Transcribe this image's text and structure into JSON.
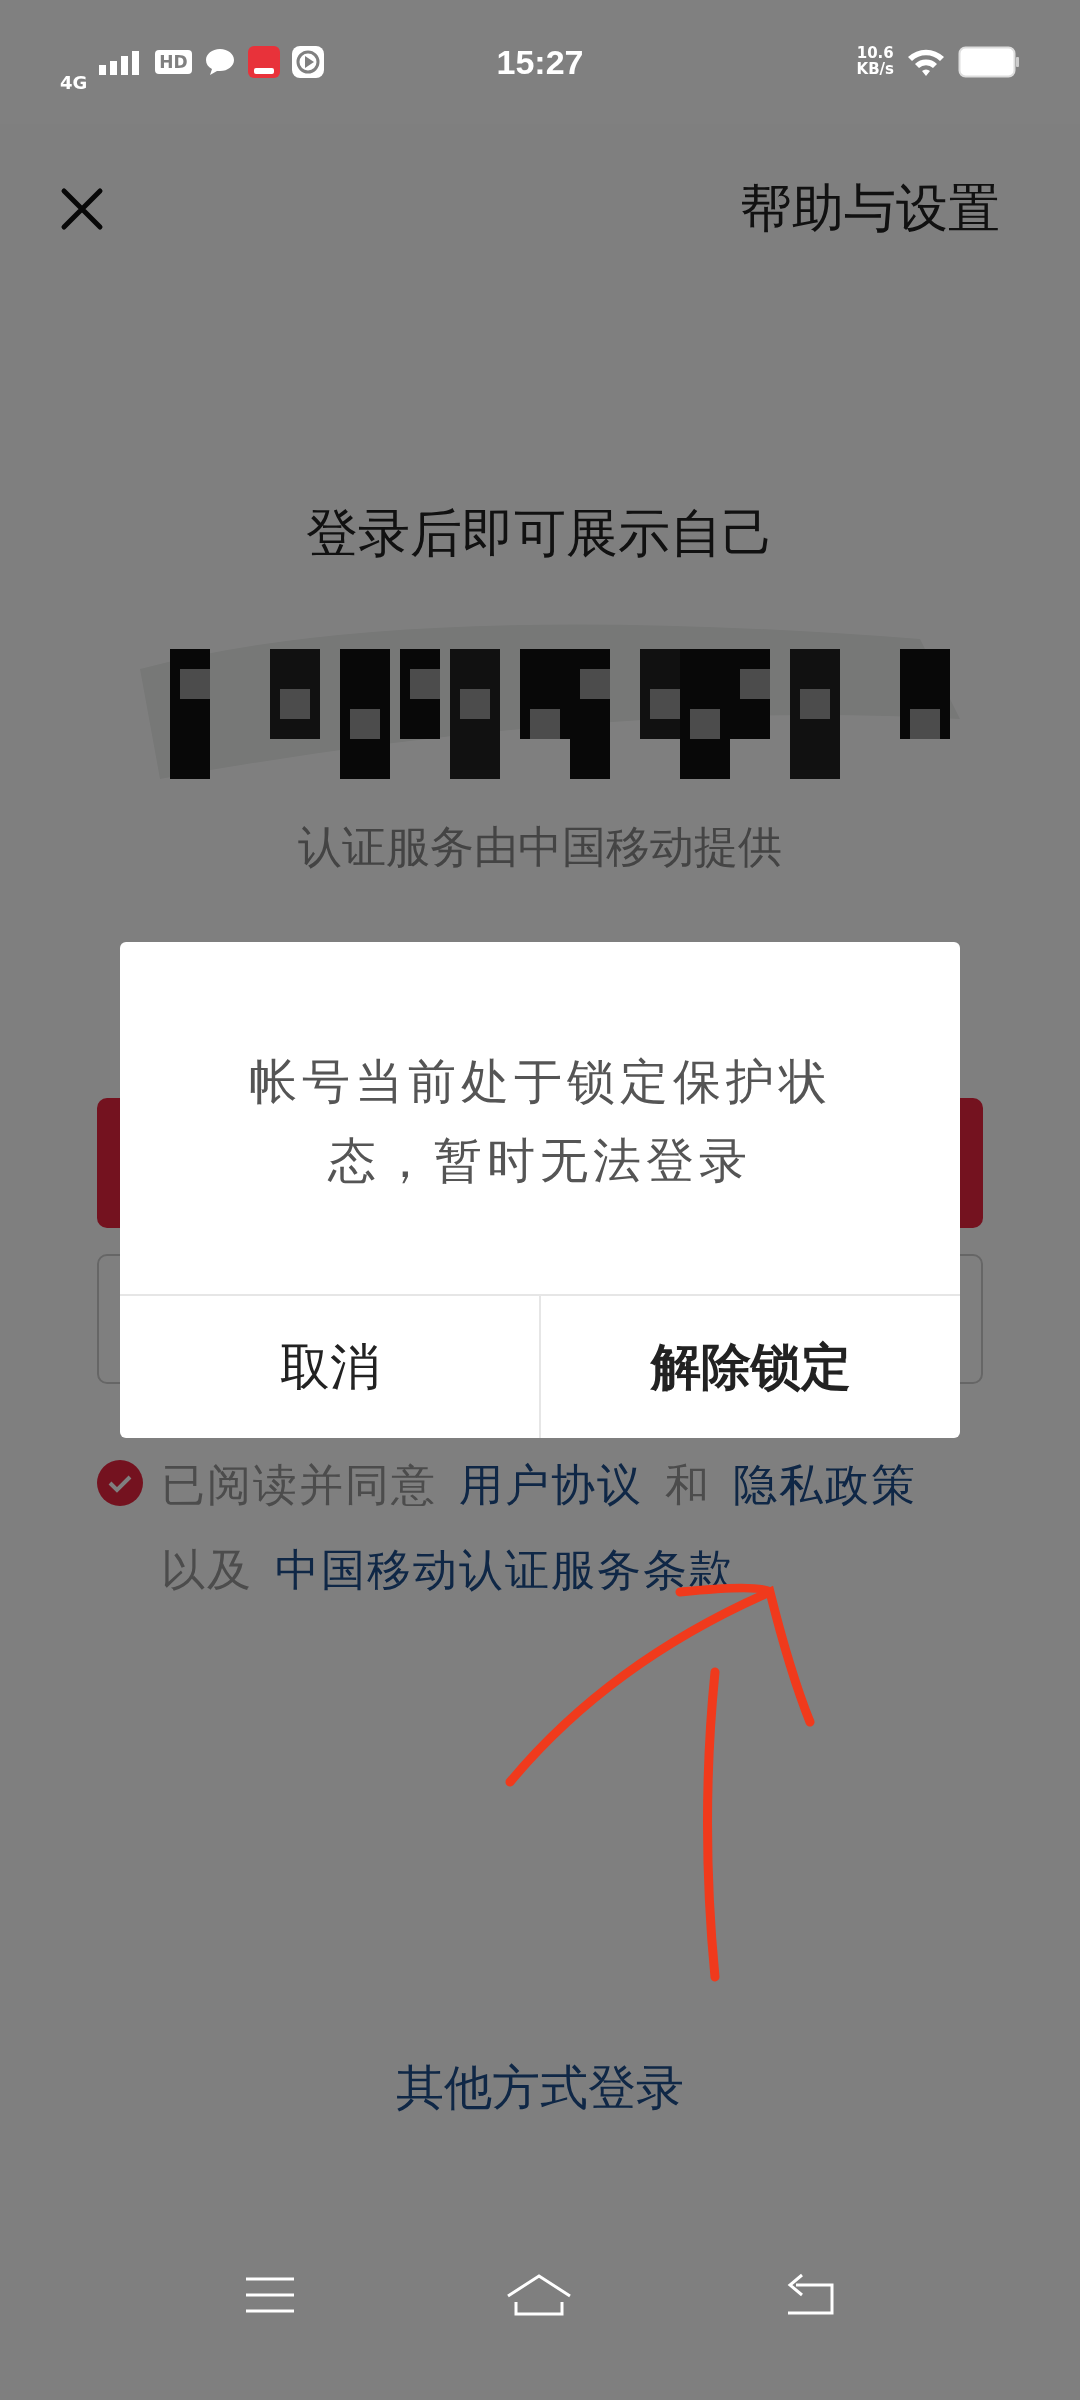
{
  "status_bar": {
    "network": "4G",
    "hd": "HD",
    "time": "15:27",
    "speed": "10.6",
    "speed_unit": "KB/s"
  },
  "header": {
    "title": "帮助与设置"
  },
  "headline": "登录后即可展示自己",
  "provider_note": "认证服务由中国移动提供",
  "agreement": {
    "checked": true,
    "lines": [
      [
        {
          "kind": "plain",
          "text": "已阅读并同意"
        },
        {
          "kind": "link",
          "text": "用户协议"
        },
        {
          "kind": "plain",
          "text": "和"
        },
        {
          "kind": "link",
          "text": "隐私政策"
        }
      ],
      [
        {
          "kind": "plain",
          "text": "以及"
        },
        {
          "kind": "link",
          "text": "中国移动认证服务条款"
        }
      ]
    ]
  },
  "other_login": "其他方式登录",
  "dialog": {
    "message": "帐号当前处于锁定保护状态，暂时无法登录",
    "buttons": [
      {
        "label": "取消",
        "primary": false
      },
      {
        "label": "解除锁定",
        "primary": true
      }
    ]
  }
}
